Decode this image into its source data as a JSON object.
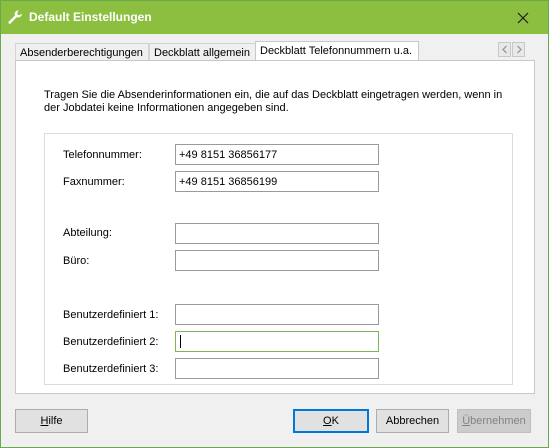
{
  "window": {
    "title": "Default Einstellungen"
  },
  "tabs": [
    {
      "label": "Absenderberechtigungen"
    },
    {
      "label": "Deckblatt allgemein"
    },
    {
      "label": "Deckblatt Telefonnummern u.a."
    }
  ],
  "page": {
    "description": "Tragen Sie die Absenderinformationen ein, die auf das Deckblatt eingetragen werden, wenn in der Jobdatei keine Informationen angegeben sind.",
    "fields": [
      {
        "label": "Telefonnummer:",
        "value": "+49 8151 36856177"
      },
      {
        "label": "Faxnummer:",
        "value": "+49 8151 36856199"
      },
      {
        "label": "Abteilung:",
        "value": ""
      },
      {
        "label": "Büro:",
        "value": ""
      },
      {
        "label": "Benutzerdefiniert 1:",
        "value": ""
      },
      {
        "label": "Benutzerdefiniert 2:",
        "value": ""
      },
      {
        "label": "Benutzerdefiniert 3:",
        "value": ""
      }
    ]
  },
  "buttons": {
    "help": {
      "mnemonic": "H",
      "rest": "ilfe"
    },
    "ok": {
      "mnemonic": "O",
      "rest": "K"
    },
    "cancel": "Abbrechen",
    "apply": {
      "mnemonic": "Ü",
      "rest": "bernehmen"
    }
  },
  "colors": {
    "titlebar": "#8cbf3f",
    "window_bg": "#f0f0f0",
    "focus_border": "#7eb4ea",
    "default_button_border": "#0078d7"
  },
  "icons": {
    "title": "wrench-icon",
    "close": "close-icon",
    "tab_prev": "chevron-left-icon",
    "tab_next": "chevron-right-icon"
  }
}
